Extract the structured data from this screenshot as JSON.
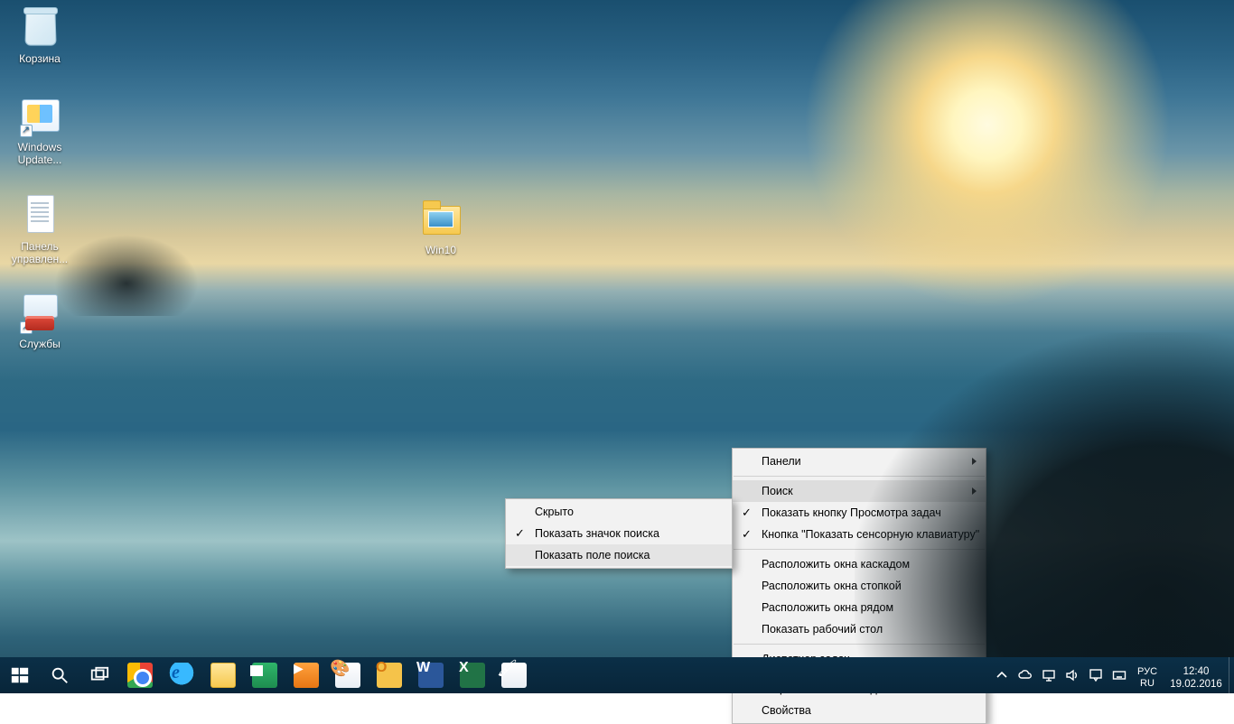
{
  "desktop": {
    "icons": [
      {
        "name": "recycle-bin",
        "label": "Корзина"
      },
      {
        "name": "windows-update",
        "label": "Windows Update..."
      },
      {
        "name": "control-panel",
        "label": "Панель управлен..."
      },
      {
        "name": "services",
        "label": "Службы"
      },
      {
        "name": "win10-folder",
        "label": "Win10"
      }
    ]
  },
  "context_menu": {
    "panels": "Панели",
    "search": "Поиск",
    "taskview": "Показать кнопку Просмотра задач",
    "touchkb": "Кнопка \"Показать сенсорную клавиатуру\"",
    "cascade": "Расположить окна каскадом",
    "stack": "Расположить окна стопкой",
    "sidebyside": "Расположить окна рядом",
    "showdesktop": "Показать рабочий стол",
    "taskmgr": "Диспетчер задач",
    "lock": "Закрепить панель задач",
    "props": "Свойства"
  },
  "search_submenu": {
    "hidden": "Скрыто",
    "show_icon": "Показать значок поиска",
    "show_box": "Показать поле поиска"
  },
  "tray": {
    "lang1": "РУС",
    "lang2": "RU",
    "time": "12:40",
    "date": "19.02.2016"
  }
}
